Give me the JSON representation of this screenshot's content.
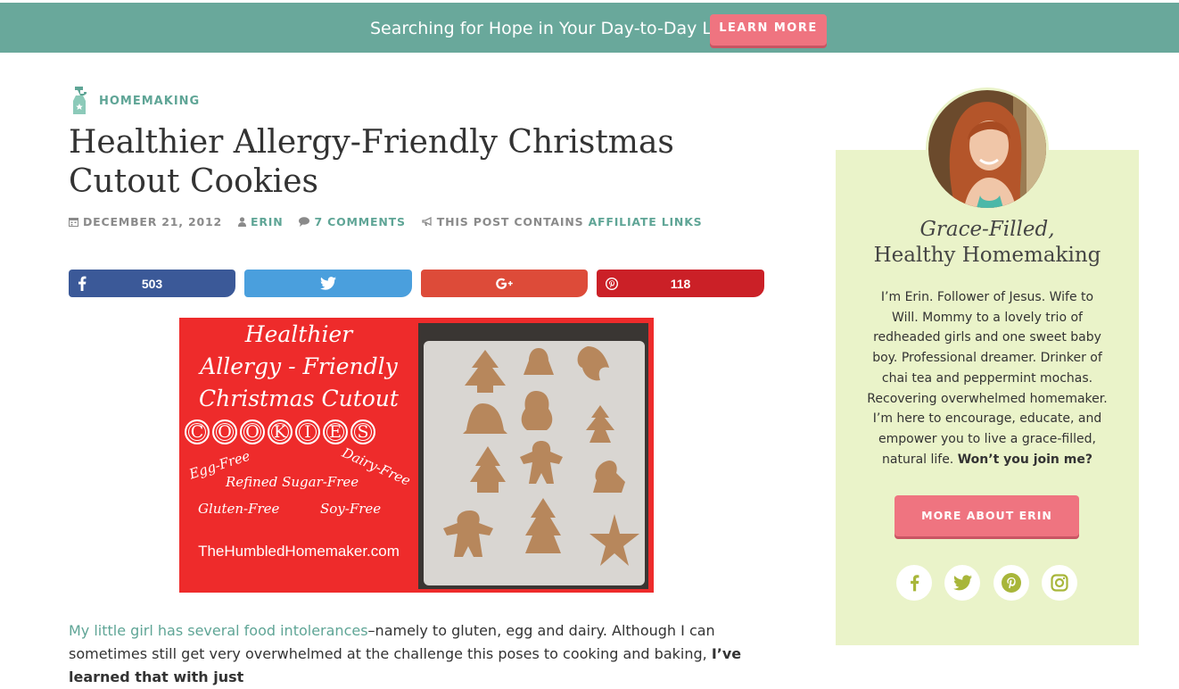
{
  "announcement": {
    "text": "Searching for Hope in Your Day-to-Day Life?",
    "button_label": "LEARN MORE"
  },
  "post": {
    "category": "HOMEMAKING",
    "title": "Healthier Allergy-Friendly Christmas Cutout Cookies",
    "date": "DECEMBER 21, 2012",
    "author": "ERIN",
    "comments": "7 COMMENTS",
    "affiliate_prefix": "THIS POST CONTAINS",
    "affiliate_link": "AFFILIATE LINKS"
  },
  "share": {
    "facebook_count": "503",
    "pinterest_count": "118"
  },
  "hero_image": {
    "line1": "Healthier",
    "line2": "Allergy - Friendly",
    "line3": "Christmas Cutout",
    "letters": [
      "C",
      "O",
      "O",
      "K",
      "I",
      "E",
      "S"
    ],
    "tag_egg": "Egg-Free",
    "tag_dairy": "Dairy-Free",
    "tag_sugar": "Refined Sugar-Free",
    "tag_gluten": "Gluten-Free",
    "tag_soy": "Soy-Free",
    "site": "TheHumbledHomemaker.com"
  },
  "body": {
    "link_text": "My little girl has several food intolerances",
    "text1": "–namely to gluten, egg and dairy. Although I can sometimes still get very overwhelmed at the challenge this poses to cooking and baking, ",
    "bold_text": "I’ve learned that with just"
  },
  "sidebar": {
    "title_italic": "Grace-Filled,",
    "title_regular": "Healthy Homemaking",
    "bio": "I’m Erin. Follower of Jesus. Wife to Will. Mommy to a lovely trio of redheaded girls and one sweet baby boy. Professional dreamer. Drinker of chai tea and peppermint mochas. Recovering overwhelmed homemaker. I’m here to encourage, educate, and empower you to live a grace-filled, natural life. ",
    "bio_bold": "Won’t you join me?",
    "button_label": "MORE ABOUT ERIN"
  },
  "colors": {
    "teal": "#69a89b",
    "pink": "#ef7480",
    "facebook": "#3b5998",
    "twitter": "#4a9fdd",
    "google": "#dd4b39",
    "pinterest": "#cb2027",
    "sidebar_bg": "#eaf3c9",
    "social_icon": "#a8b63a"
  }
}
